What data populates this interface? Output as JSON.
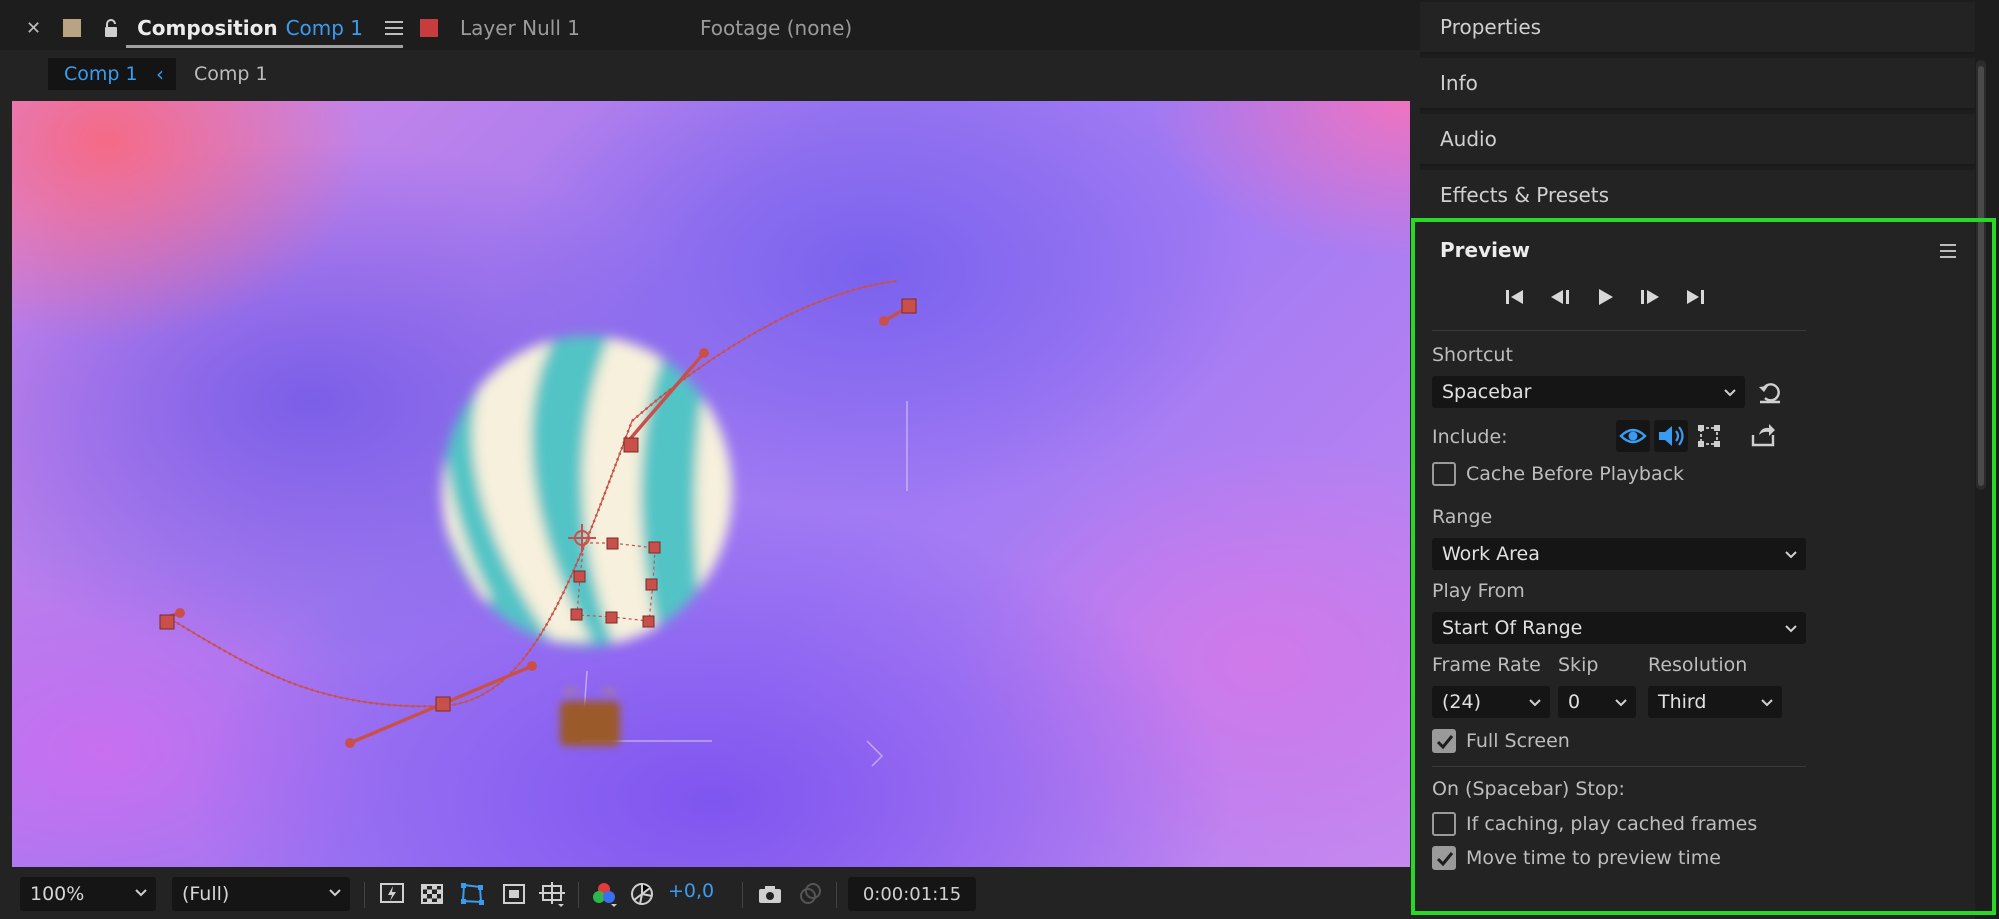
{
  "tabs": {
    "composition_label": "Composition",
    "composition_name": "Comp 1",
    "layer_label": "Layer Null 1",
    "footage_label": "Footage (none)"
  },
  "breadcrumb": {
    "active": "Comp 1",
    "next": "Comp 1"
  },
  "viewer_toolbar": {
    "zoom": "100%",
    "resolution": "(Full)",
    "exposure": "+0,0",
    "timecode": "0:00:01:15"
  },
  "panels": {
    "properties": "Properties",
    "info": "Info",
    "audio": "Audio",
    "effects_presets": "Effects & Presets"
  },
  "preview": {
    "title": "Preview",
    "shortcut_label": "Shortcut",
    "shortcut_value": "Spacebar",
    "include_label": "Include:",
    "cache_before_playback": "Cache Before Playback",
    "cache_before_playback_checked": false,
    "range_label": "Range",
    "range_value": "Work Area",
    "play_from_label": "Play From",
    "play_from_value": "Start Of Range",
    "frame_rate_label": "Frame Rate",
    "frame_rate_value": "(24)",
    "skip_label": "Skip",
    "skip_value": "0",
    "resolution_label": "Resolution",
    "resolution_value": "Third",
    "full_screen": "Full Screen",
    "full_screen_checked": true,
    "on_stop_label": "On (Spacebar) Stop:",
    "play_cached_frames": "If caching, play cached frames",
    "play_cached_frames_checked": false,
    "move_time": "Move time to preview time",
    "move_time_checked": true
  },
  "colors": {
    "accent_blue": "#3a9cf0",
    "highlight_green": "#27d827",
    "path_red": "#c9504a",
    "comp_swatch": "#b8a383",
    "layer_swatch": "#c73c3c"
  }
}
